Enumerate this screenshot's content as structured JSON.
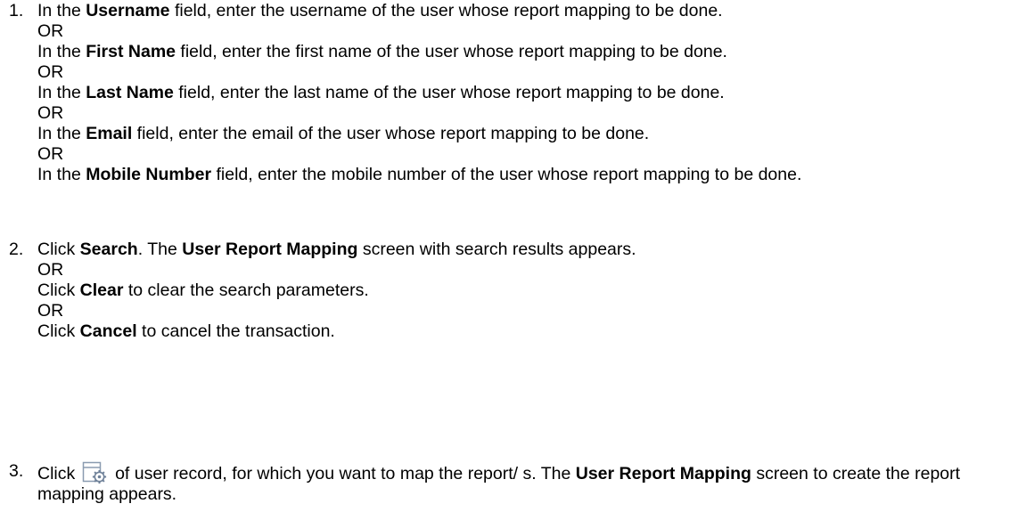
{
  "step1": {
    "number": "1.",
    "lines": [
      {
        "pre": "In the ",
        "bold": "Username",
        "post": " field, enter the username of the user whose report mapping to be done."
      },
      {
        "plain": "OR"
      },
      {
        "pre": "In the ",
        "bold": "First Name",
        "post": " field, enter the first name of the user whose report mapping to be done."
      },
      {
        "plain": "OR"
      },
      {
        "pre": "In the ",
        "bold": "Last Name",
        "post": " field, enter the last name of the user whose report mapping to be done."
      },
      {
        "plain": "OR"
      },
      {
        "pre": "In the ",
        "bold": "Email",
        "post": " field, enter the email of the user whose report mapping to be done."
      },
      {
        "plain": "OR"
      },
      {
        "pre": "In the ",
        "bold": "Mobile Number",
        "post": " field, enter the mobile number of the user whose report mapping to be done."
      }
    ]
  },
  "step2": {
    "number": "2.",
    "line1": {
      "pre": "Click ",
      "bold1": "Search",
      "mid": ". The ",
      "bold2": "User Report Mapping",
      "post": " screen with search results appears."
    },
    "or1": "OR",
    "line2": {
      "pre": "Click ",
      "bold": "Clear",
      "post": " to clear the search parameters."
    },
    "or2": "OR",
    "line3": {
      "pre": "Click ",
      "bold": "Cancel",
      "post": " to cancel the transaction."
    }
  },
  "step3": {
    "number": "3.",
    "pre": "Click ",
    "icon": "report-mapping-settings-icon",
    "mid": " of user record, for which you want to map the report/ s. The ",
    "bold": "User Report Mapping",
    "post": " screen to create the report mapping appears."
  }
}
